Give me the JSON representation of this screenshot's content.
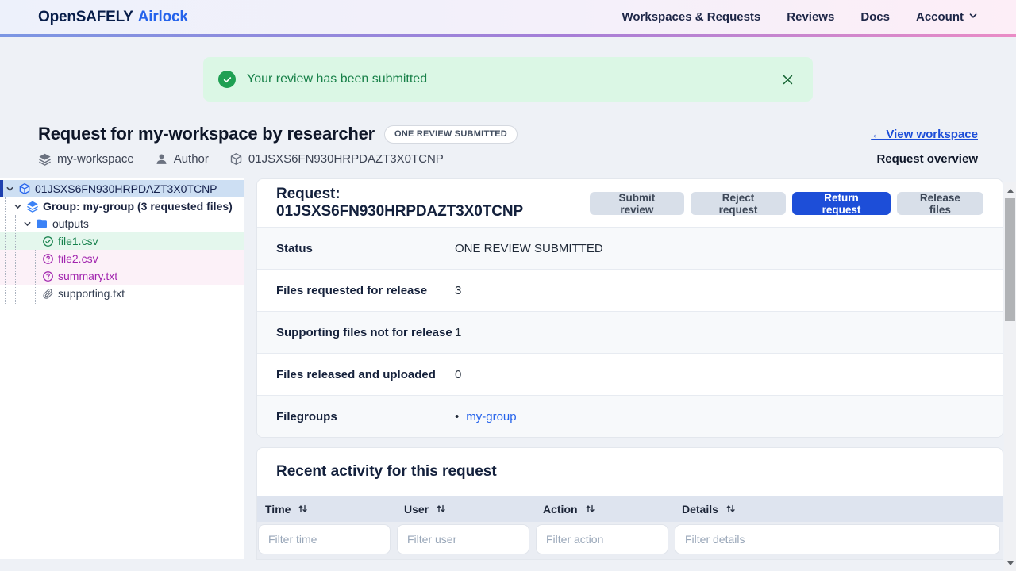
{
  "colors": {
    "accent": "#1d4ed8",
    "link": "#2563eb",
    "success_bg": "#dbf7e5",
    "success_text": "#178048",
    "nav_gradient": [
      "#7b96e3",
      "#a57ed7",
      "#ea8cc6"
    ],
    "selected_row_bg": "#cddff3",
    "approved_text": "#16814c",
    "undecided_text": "#a226af"
  },
  "navbar": {
    "brand_primary": "OpenSAFELY",
    "brand_secondary": "Airlock",
    "links": [
      {
        "label": "Workspaces & Requests"
      },
      {
        "label": "Reviews"
      },
      {
        "label": "Docs"
      }
    ],
    "account_label": "Account"
  },
  "alert": {
    "message": "Your review has been submitted"
  },
  "header": {
    "title": "Request for my-workspace by researcher",
    "status_badge": "ONE REVIEW SUBMITTED",
    "view_workspace_link": "← View workspace",
    "overview_label": "Request overview",
    "meta": [
      {
        "icon": "layers-icon",
        "label": "my-workspace"
      },
      {
        "icon": "user-icon",
        "label": "Author"
      },
      {
        "icon": "cube-icon",
        "label": "01JSXS6FN930HRPDAZT3X0TCNP"
      }
    ]
  },
  "tree": {
    "items": [
      {
        "label": "01JSXS6FN930HRPDAZT3X0TCNP",
        "icon": "cube-icon",
        "state": "selected"
      },
      {
        "label": "Group: my-group (3 requested files)",
        "icon": "layers-icon",
        "state": "group"
      },
      {
        "label": "outputs",
        "icon": "folder-icon",
        "state": "folder"
      },
      {
        "label": "file1.csv",
        "icon": "check-circle-icon",
        "state": "approved"
      },
      {
        "label": "file2.csv",
        "icon": "question-circle-icon",
        "state": "undecided"
      },
      {
        "label": "summary.txt",
        "icon": "question-circle-icon",
        "state": "undecided"
      },
      {
        "label": "supporting.txt",
        "icon": "paperclip-icon",
        "state": "supporting"
      }
    ]
  },
  "request": {
    "title": "Request: 01JSXS6FN930HRPDAZT3X0TCNP",
    "buttons": [
      {
        "label": "Submit review",
        "variant": "muted"
      },
      {
        "label": "Reject request",
        "variant": "muted"
      },
      {
        "label": "Return request",
        "variant": "primary"
      },
      {
        "label": "Release files",
        "variant": "muted"
      }
    ],
    "filegroups_bullet": "•",
    "details": [
      {
        "label": "Status",
        "value": "ONE REVIEW SUBMITTED"
      },
      {
        "label": "Files requested for release",
        "value": "3"
      },
      {
        "label": "Supporting files not for release",
        "value": "1"
      },
      {
        "label": "Files released and uploaded",
        "value": "0"
      },
      {
        "label": "Filegroups",
        "value": "my-group",
        "is_link": true
      }
    ]
  },
  "activity": {
    "title": "Recent activity for this request",
    "columns": [
      {
        "label": "Time",
        "filter_placeholder": "Filter time"
      },
      {
        "label": "User",
        "filter_placeholder": "Filter user"
      },
      {
        "label": "Action",
        "filter_placeholder": "Filter action"
      },
      {
        "label": "Details",
        "filter_placeholder": "Filter details"
      }
    ]
  }
}
